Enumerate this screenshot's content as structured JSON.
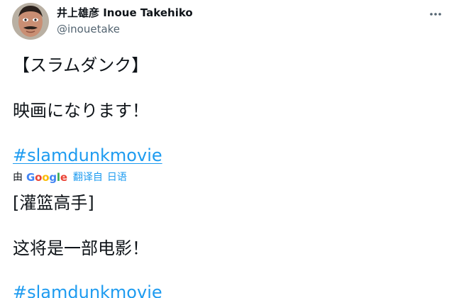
{
  "author": {
    "display_name": "井上雄彦 Inoue Takehiko",
    "handle": "@inouetake"
  },
  "icons": {
    "more": "more-horizontal-icon",
    "avatar": "profile-photo"
  },
  "tweet": {
    "original_lines": [
      "【スラムダンク】",
      "映画になります！",
      "#slamdunkmovie"
    ],
    "translation_bar": {
      "by": "由",
      "provider": "Google",
      "translated_from": "翻译自",
      "language": "日语"
    },
    "translated_lines": [
      "[灌篮高手]",
      "这将是一部电影！",
      "#slamdunkmovie"
    ]
  },
  "colors": {
    "text": "#0f1419",
    "secondary": "#536471",
    "link": "#1d9bf0"
  }
}
